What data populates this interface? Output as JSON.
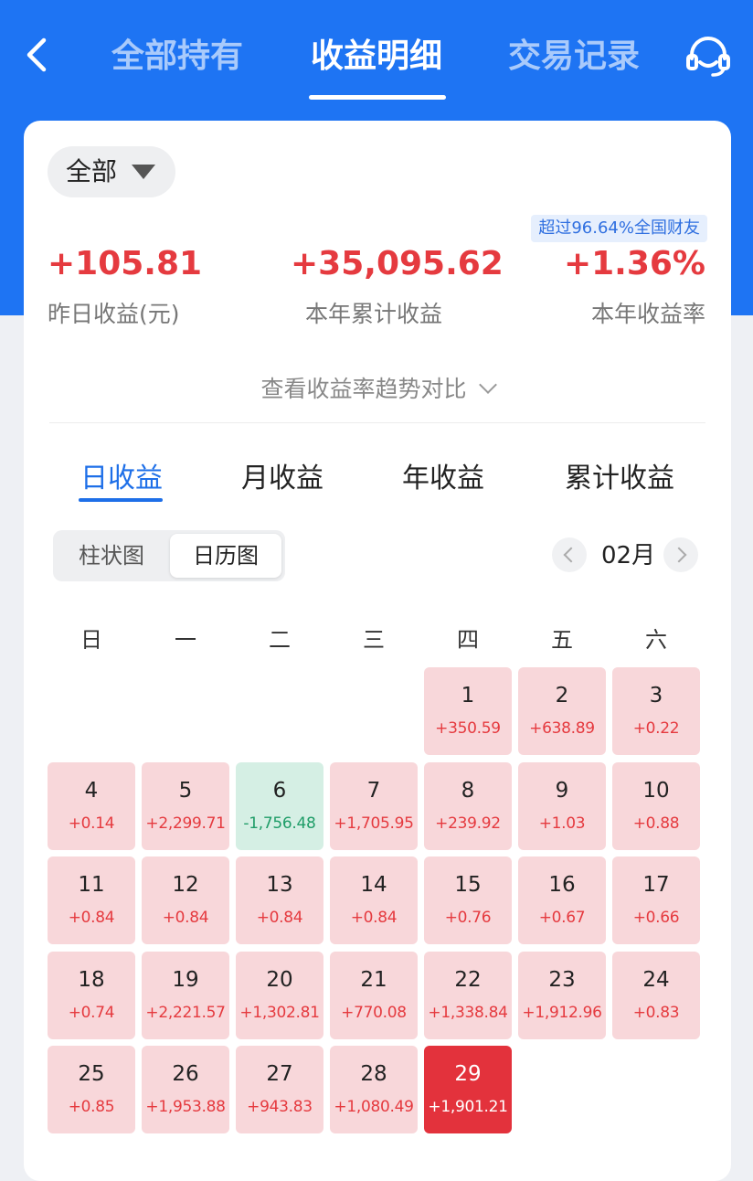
{
  "header": {
    "tabs": [
      "全部持有",
      "收益明细",
      "交易记录"
    ],
    "active_tab": "收益明细"
  },
  "filter": {
    "label": "全部"
  },
  "rank_badge": "超过96.64%全国财友",
  "stats": {
    "yesterday": {
      "value": "+105.81",
      "label": "昨日收益(元)"
    },
    "year_total": {
      "value": "+35,095.62",
      "label": "本年累计收益"
    },
    "year_rate": {
      "value": "+1.36%",
      "label": "本年收益率"
    }
  },
  "trend_link": "查看收益率趋势对比",
  "period_tabs": [
    "日收益",
    "月收益",
    "年收益",
    "累计收益"
  ],
  "active_period": "日收益",
  "view_toggle": [
    "柱状图",
    "日历图"
  ],
  "active_view": "日历图",
  "month": "02月",
  "weekdays": [
    "日",
    "一",
    "二",
    "三",
    "四",
    "五",
    "六"
  ],
  "calendar": [
    {
      "day": "1",
      "value": "+350.59",
      "type": "pos"
    },
    {
      "day": "2",
      "value": "+638.89",
      "type": "pos"
    },
    {
      "day": "3",
      "value": "+0.22",
      "type": "pos"
    },
    {
      "day": "4",
      "value": "+0.14",
      "type": "pos"
    },
    {
      "day": "5",
      "value": "+2,299.71",
      "type": "pos"
    },
    {
      "day": "6",
      "value": "-1,756.48",
      "type": "neg"
    },
    {
      "day": "7",
      "value": "+1,705.95",
      "type": "pos"
    },
    {
      "day": "8",
      "value": "+239.92",
      "type": "pos"
    },
    {
      "day": "9",
      "value": "+1.03",
      "type": "pos"
    },
    {
      "day": "10",
      "value": "+0.88",
      "type": "pos"
    },
    {
      "day": "11",
      "value": "+0.84",
      "type": "pos"
    },
    {
      "day": "12",
      "value": "+0.84",
      "type": "pos"
    },
    {
      "day": "13",
      "value": "+0.84",
      "type": "pos"
    },
    {
      "day": "14",
      "value": "+0.84",
      "type": "pos"
    },
    {
      "day": "15",
      "value": "+0.76",
      "type": "pos"
    },
    {
      "day": "16",
      "value": "+0.67",
      "type": "pos"
    },
    {
      "day": "17",
      "value": "+0.66",
      "type": "pos"
    },
    {
      "day": "18",
      "value": "+0.74",
      "type": "pos"
    },
    {
      "day": "19",
      "value": "+2,221.57",
      "type": "pos"
    },
    {
      "day": "20",
      "value": "+1,302.81",
      "type": "pos"
    },
    {
      "day": "21",
      "value": "+770.08",
      "type": "pos"
    },
    {
      "day": "22",
      "value": "+1,338.84",
      "type": "pos"
    },
    {
      "day": "23",
      "value": "+1,912.96",
      "type": "pos"
    },
    {
      "day": "24",
      "value": "+0.83",
      "type": "pos"
    },
    {
      "day": "25",
      "value": "+0.85",
      "type": "pos"
    },
    {
      "day": "26",
      "value": "+1,953.88",
      "type": "pos"
    },
    {
      "day": "27",
      "value": "+943.83",
      "type": "pos"
    },
    {
      "day": "28",
      "value": "+1,080.49",
      "type": "pos"
    },
    {
      "day": "29",
      "value": "+1,901.21",
      "type": "today"
    }
  ],
  "colors": {
    "brand_blue": "#1e74f3",
    "gain_red": "#e53a3f",
    "loss_green": "#1f9d68",
    "today_red": "#e3323c"
  }
}
